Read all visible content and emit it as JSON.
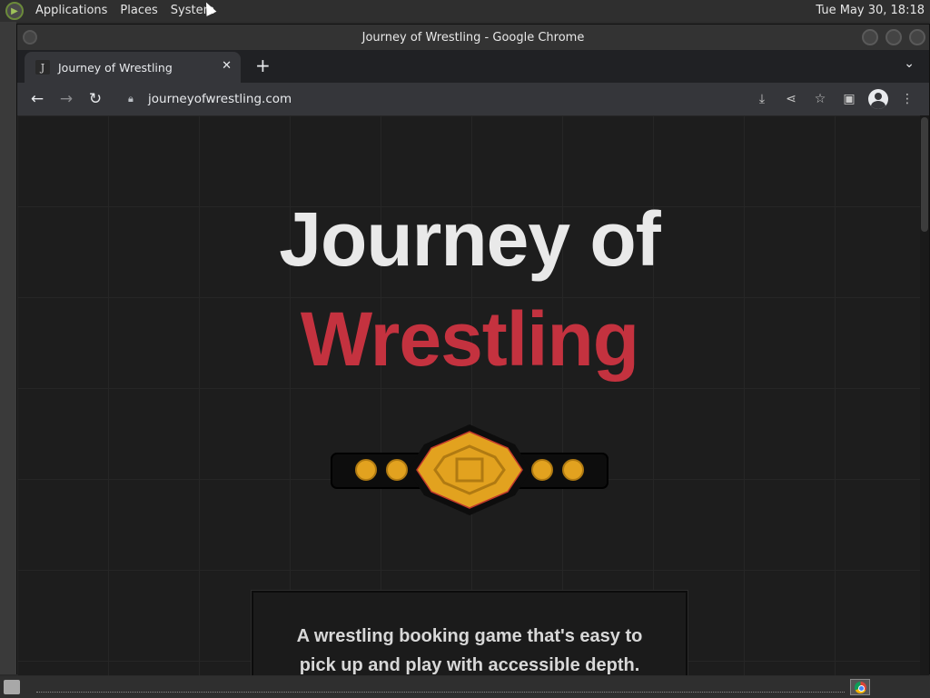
{
  "desktop": {
    "menu": [
      "Applications",
      "Places",
      "System"
    ],
    "clock": "Tue May 30, 18:18"
  },
  "window": {
    "title": "Journey of Wrestling - Google Chrome"
  },
  "browser": {
    "tab": {
      "title": "Journey of Wrestling",
      "favicon": "J"
    },
    "url": "journeyofwrestling.com",
    "icons": [
      "back-icon",
      "forward-icon",
      "reload-icon",
      "lock-icon",
      "install-icon",
      "share-icon",
      "bookmark-star-icon",
      "side-panel-icon",
      "profile-icon",
      "kebab-menu-icon"
    ]
  },
  "page": {
    "title_line1": "Journey of",
    "title_line2": "Wrestling",
    "tagline": "A wrestling booking game that's easy to pick up and play with accessible depth.",
    "colors": {
      "title": "#e9e9e9",
      "accent": "#c4323f",
      "belt_gold": "#e2a21f",
      "background": "#1d1d1d"
    }
  }
}
